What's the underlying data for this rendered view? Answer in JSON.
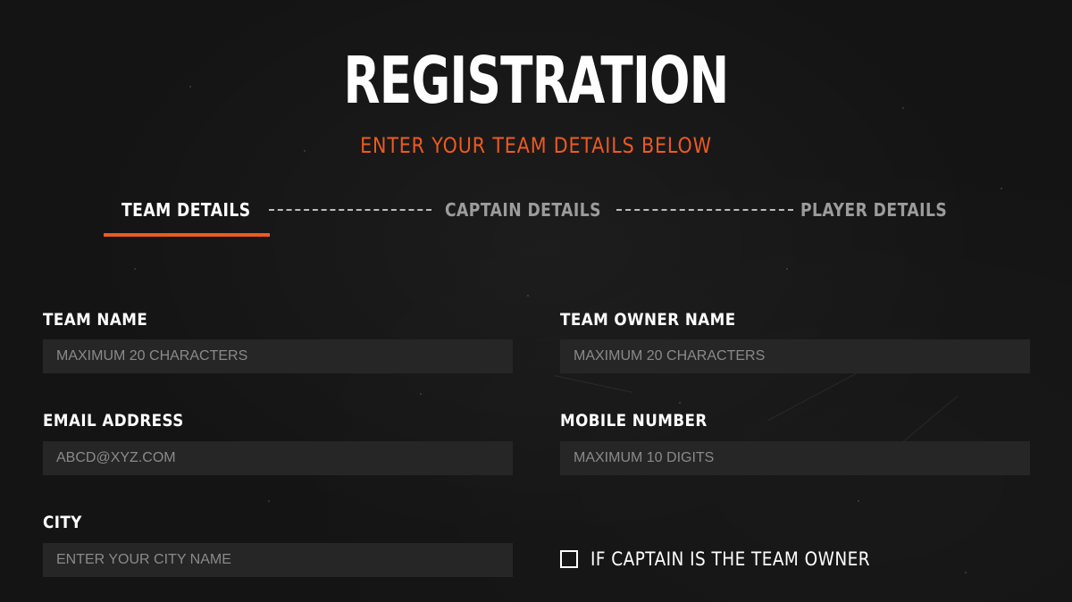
{
  "header": {
    "title": "REGISTRATION",
    "subtitle": "ENTER YOUR TEAM DETAILS BELOW"
  },
  "steps": [
    {
      "label": "TEAM DETAILS",
      "active": true
    },
    {
      "label": "CAPTAIN DETAILS",
      "active": false
    },
    {
      "label": "PLAYER DETAILS",
      "active": false
    }
  ],
  "form": {
    "team_name": {
      "label": "TEAM NAME",
      "placeholder": "MAXIMUM 20 CHARACTERS",
      "value": ""
    },
    "team_owner_name": {
      "label": "TEAM OWNER NAME",
      "placeholder": "MAXIMUM 20 CHARACTERS",
      "value": ""
    },
    "email": {
      "label": "EMAIL ADDRESS",
      "placeholder": "ABCD@XYZ.COM",
      "value": ""
    },
    "mobile": {
      "label": "MOBILE NUMBER",
      "placeholder": "MAXIMUM 10 DIGITS",
      "value": ""
    },
    "city": {
      "label": "CITY",
      "placeholder": "ENTER YOUR CITY NAME",
      "value": ""
    },
    "captain_is_owner": {
      "label": "IF CAPTAIN IS THE TEAM OWNER",
      "checked": false
    }
  },
  "colors": {
    "accent": "#ee5a1f",
    "background": "#141414",
    "input_background": "#262626",
    "inactive_step": "#9c9c9c"
  }
}
